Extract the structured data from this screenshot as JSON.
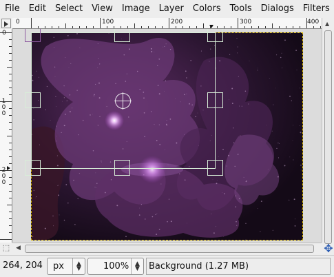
{
  "menubar": {
    "items": [
      "File",
      "Edit",
      "Select",
      "View",
      "Image",
      "Layer",
      "Colors",
      "Tools",
      "Dialogs",
      "Filters"
    ]
  },
  "ruler": {
    "horizontal_labels": [
      "0",
      "100",
      "200",
      "300",
      "400"
    ],
    "vertical_labels": [
      "0",
      "100",
      "200"
    ]
  },
  "canvas": {
    "layer_name": "Background",
    "selection": "rectangle-with-handles"
  },
  "statusbar": {
    "coordinates": "264, 204",
    "unit": "px",
    "zoom": "100%",
    "message": "Background (1.27 MB)"
  },
  "icons": {
    "ruler_corner": "quick-mask-arrow-icon",
    "navigate": "navigate-cross-icon",
    "zoom_corner": "dashed-corner-icon"
  }
}
